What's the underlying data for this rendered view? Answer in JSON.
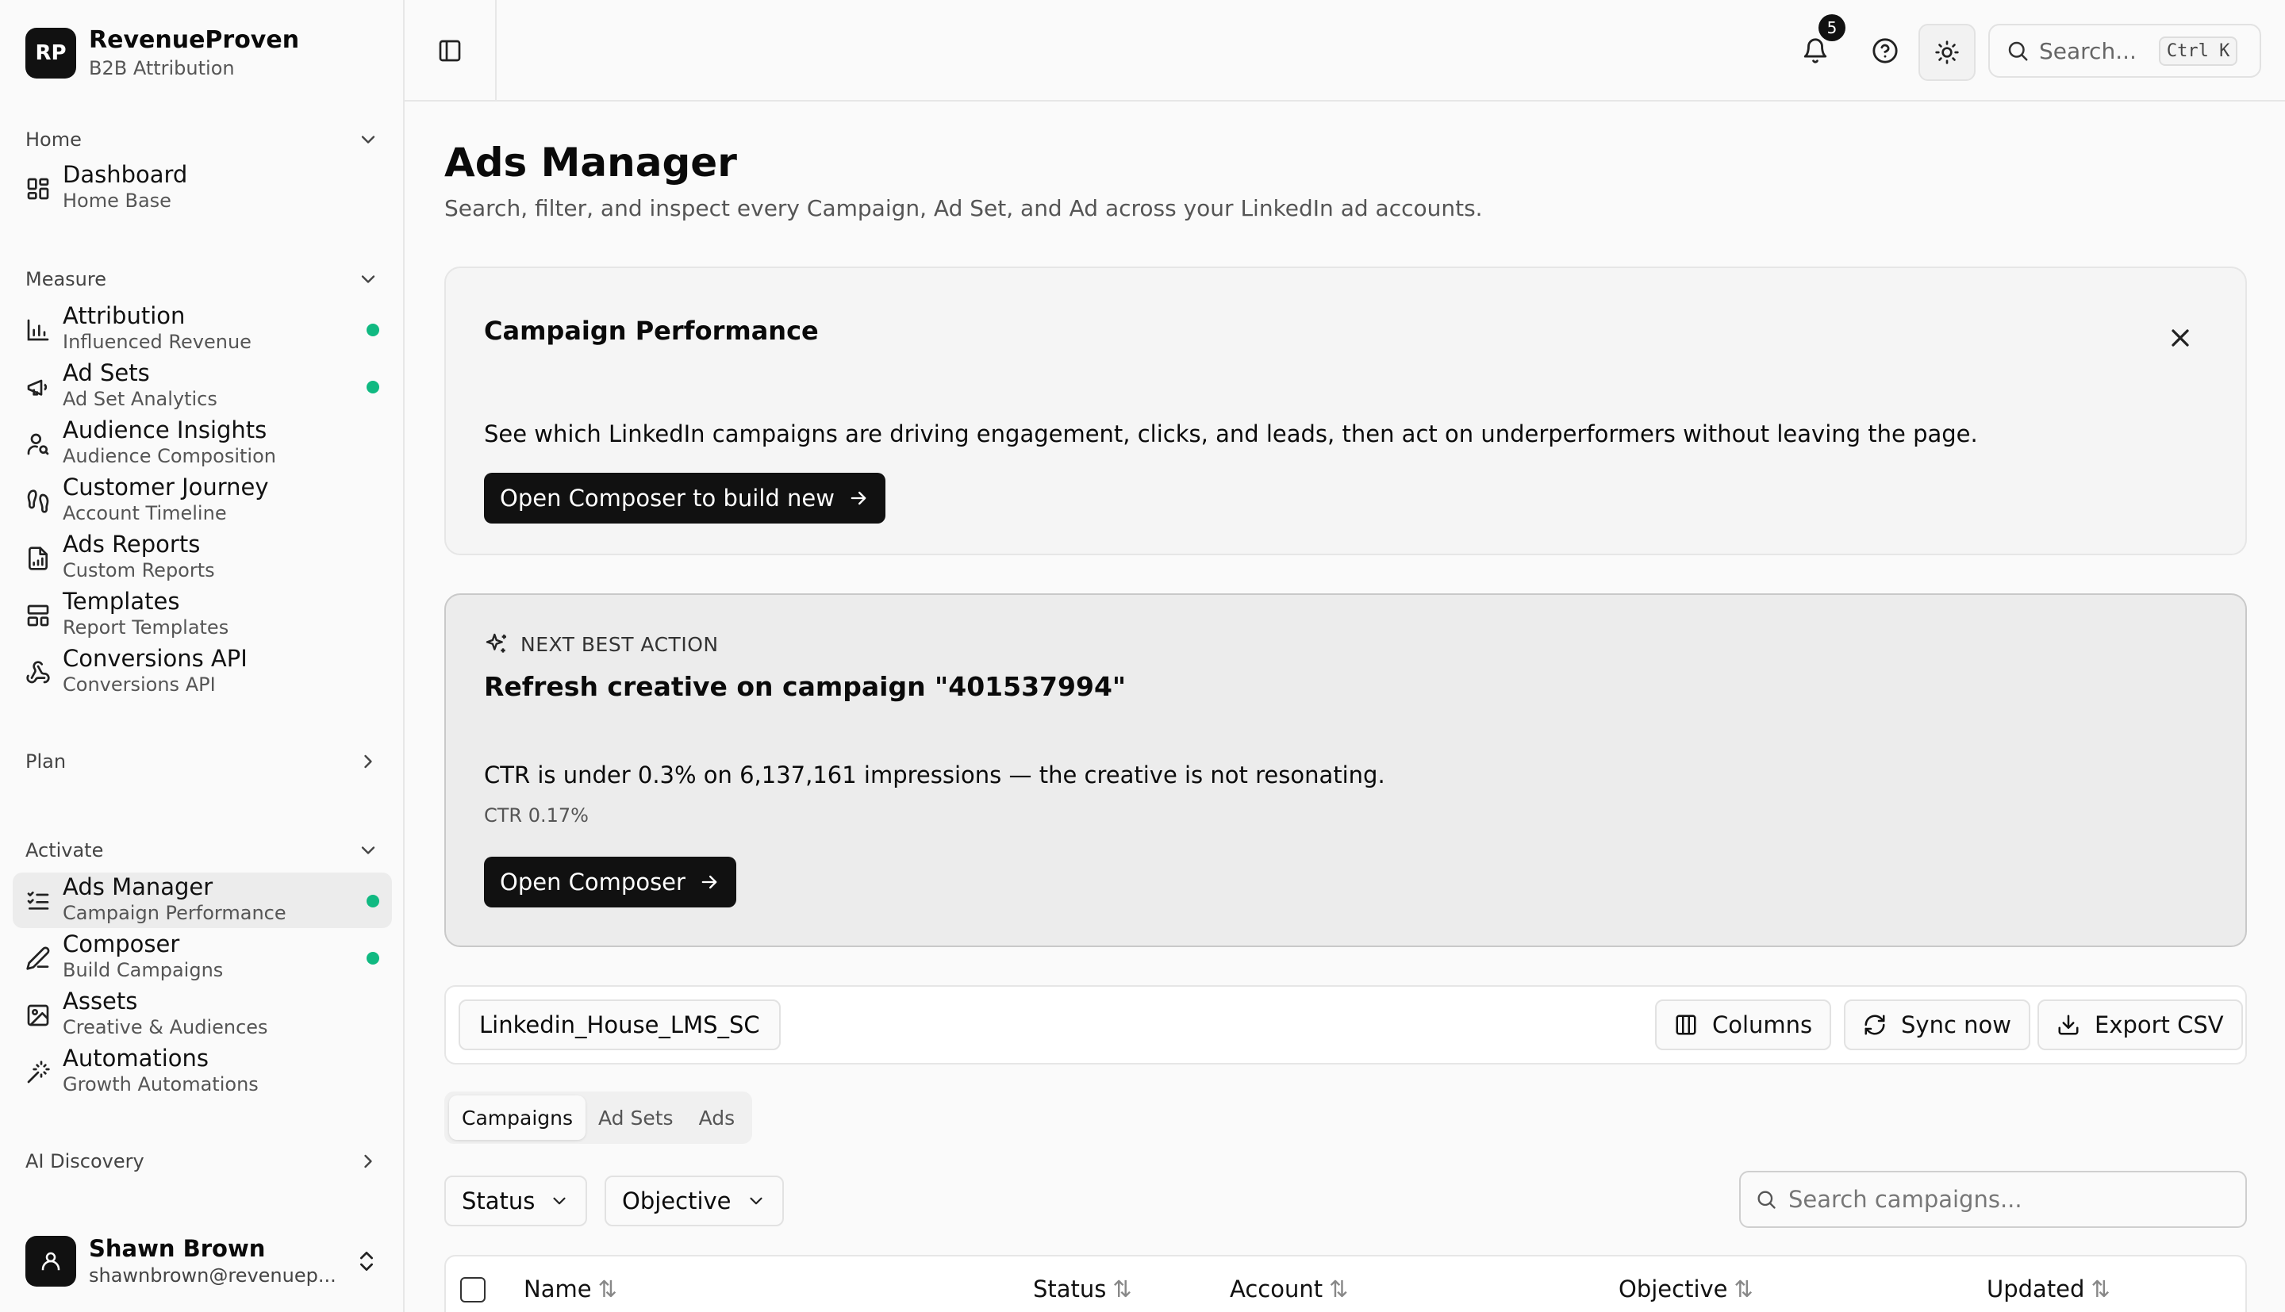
{
  "brand": {
    "logo": "RP",
    "name": "RevenueProven",
    "sub": "B2B Attribution"
  },
  "groups": {
    "home": "Home",
    "measure": "Measure",
    "plan": "Plan",
    "activate": "Activate",
    "ai_discovery": "AI Discovery"
  },
  "nav": {
    "dashboard": {
      "label": "Dashboard",
      "sub": "Home Base",
      "icon": "grid-icon"
    },
    "attribution": {
      "label": "Attribution",
      "sub": "Influenced Revenue",
      "icon": "bar-chart-icon"
    },
    "ad_sets": {
      "label": "Ad Sets",
      "sub": "Ad Set Analytics",
      "icon": "megaphone-icon"
    },
    "audience": {
      "label": "Audience Insights",
      "sub": "Audience Composition",
      "icon": "user-search-icon"
    },
    "journey": {
      "label": "Customer Journey",
      "sub": "Account Timeline",
      "icon": "footprints-icon"
    },
    "reports": {
      "label": "Ads Reports",
      "sub": "Custom Reports",
      "icon": "file-chart-icon"
    },
    "templates": {
      "label": "Templates",
      "sub": "Report Templates",
      "icon": "layout-icon"
    },
    "capi": {
      "label": "Conversions API",
      "sub": "Conversions API",
      "icon": "webhook-icon"
    },
    "ads_manager": {
      "label": "Ads Manager",
      "sub": "Campaign Performance",
      "icon": "list-check-icon"
    },
    "composer": {
      "label": "Composer",
      "sub": "Build Campaigns",
      "icon": "pen-icon"
    },
    "assets": {
      "label": "Assets",
      "sub": "Creative & Audiences",
      "icon": "image-icon"
    },
    "automations": {
      "label": "Automations",
      "sub": "Growth Automations",
      "icon": "wand-icon"
    }
  },
  "user": {
    "name": "Shawn Brown",
    "email": "shawnbrown@revenuep..."
  },
  "topbar": {
    "notifications": "5",
    "search_placeholder": "Search...",
    "shortcut": "Ctrl K"
  },
  "page": {
    "title": "Ads Manager",
    "description": "Search, filter, and inspect every Campaign, Ad Set, and Ad across your LinkedIn ad accounts."
  },
  "performance_card": {
    "title": "Campaign Performance",
    "description": "See which LinkedIn campaigns are driving engagement, clicks, and leads, then act on underperformers without leaving the page.",
    "button": "Open Composer to build new"
  },
  "nba_card": {
    "eyebrow": "NEXT BEST ACTION",
    "title": "Refresh creative on campaign \"401537994\"",
    "description": "CTR is under 0.3% on 6,137,161 impressions — the creative is not resonating.",
    "metric": "CTR 0.17%",
    "button": "Open Composer"
  },
  "toolbar": {
    "account": "Linkedin_House_LMS_SC",
    "columns": "Columns",
    "sync": "Sync now",
    "export": "Export CSV"
  },
  "tabs": [
    "Campaigns",
    "Ad Sets",
    "Ads"
  ],
  "filters": {
    "status": "Status",
    "objective": "Objective",
    "search_placeholder": "Search campaigns..."
  },
  "table": {
    "columns": [
      "Name",
      "Status",
      "Account",
      "Objective",
      "Updated"
    ]
  },
  "colors": {
    "accent_dot": "#10b981",
    "primary_button": "#111111"
  }
}
